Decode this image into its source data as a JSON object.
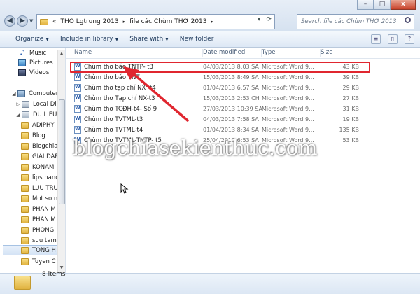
{
  "window": {
    "minimize": "–",
    "maximize": "□",
    "close": "x"
  },
  "address": {
    "prefix": "«",
    "crumbs": [
      "THO Lgtrung 2013",
      "file các Chùm THƠ 2013"
    ],
    "separator": "▸"
  },
  "search": {
    "placeholder": "Search file các Chùm THƠ 2013"
  },
  "toolbar": {
    "organize": "Organize",
    "include": "Include in library",
    "share": "Share with",
    "new_folder": "New folder"
  },
  "sidebar": {
    "items": [
      {
        "label": "Music",
        "icon": "music-icon"
      },
      {
        "label": "Pictures",
        "icon": "pictures-icon"
      },
      {
        "label": "Videos",
        "icon": "videos-icon"
      },
      {
        "label": "Computer",
        "icon": "computer-icon"
      },
      {
        "label": "Local Disk",
        "icon": "disk-icon"
      },
      {
        "label": "DU LIEU (D",
        "icon": "disk-icon"
      },
      {
        "label": "ADIPHY",
        "icon": "folder-icon"
      },
      {
        "label": "Blog",
        "icon": "folder-icon"
      },
      {
        "label": "Blogchia",
        "icon": "folder-icon"
      },
      {
        "label": "GIAI DAP",
        "icon": "folder-icon"
      },
      {
        "label": "KONAMI",
        "icon": "folder-icon"
      },
      {
        "label": "lips hand",
        "icon": "folder-icon"
      },
      {
        "label": "LUU TRU",
        "icon": "folder-icon"
      },
      {
        "label": "Mot so n",
        "icon": "folder-icon"
      },
      {
        "label": "PHAN M",
        "icon": "folder-icon"
      },
      {
        "label": "PHAN M",
        "icon": "folder-icon"
      },
      {
        "label": "PHONG",
        "icon": "folder-icon"
      },
      {
        "label": "suu tam",
        "icon": "folder-icon"
      },
      {
        "label": "TONG H",
        "icon": "folder-icon"
      },
      {
        "label": "Tuyen C",
        "icon": "folder-icon"
      }
    ]
  },
  "columns": [
    "Name",
    "Date modified",
    "Type",
    "Size"
  ],
  "files": [
    {
      "name": "Chùm thơ báo TNTP- t3",
      "date": "04/03/2013 8:03 SA",
      "type": "Microsoft Word 9...",
      "size": "43 KB"
    },
    {
      "name": "Chùm thơ báo TNT",
      "date": "15/03/2013 8:49 SA",
      "type": "Microsoft Word 9...",
      "size": "39 KB"
    },
    {
      "name": "Chùm thơ tạp chí NX -t4",
      "date": "01/04/2013 6:57 SA",
      "type": "Microsoft Word 9...",
      "size": "29 KB"
    },
    {
      "name": "Chùm thơ Tạp chí NX-t3",
      "date": "15/03/2013 2:53 CH",
      "type": "Microsoft Word 9...",
      "size": "27 KB"
    },
    {
      "name": "Chùm thơ TCĐH-t4- Số 9",
      "date": "27/03/2013 10:39 SA",
      "type": "Microsoft Word 9...",
      "size": "31 KB"
    },
    {
      "name": "Chùm thơ TVTML-t3",
      "date": "04/03/2013 7:58 SA",
      "type": "Microsoft Word 9...",
      "size": "19 KB"
    },
    {
      "name": "Chùm thơ TVTML-t4",
      "date": "01/04/2013 8:34 SA",
      "type": "Microsoft Word 9...",
      "size": "135 KB"
    },
    {
      "name": "Chùm thơ TVTML-TNTP- t5",
      "date": "25/04/2013 6:53 SA",
      "type": "Microsoft Word 9...",
      "size": "53 KB"
    }
  ],
  "watermark": "blogchiasekienthuc.com",
  "status": {
    "count": "8 items"
  }
}
